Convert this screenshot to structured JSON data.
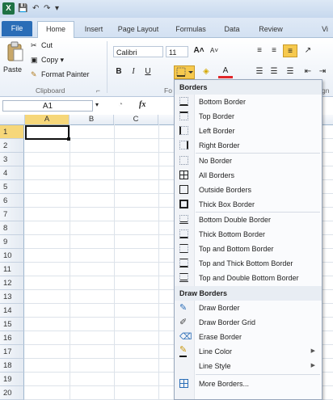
{
  "app": {
    "logo": "X"
  },
  "quick_access": {
    "save": "💾",
    "undo": "↶",
    "redo": "↷",
    "customize": "▾"
  },
  "tabs": [
    "File",
    "Home",
    "Insert",
    "Page Layout",
    "Formulas",
    "Data",
    "Review",
    "Vi"
  ],
  "clipboard": {
    "paste_label": "Paste",
    "cut_label": "Cut",
    "copy_label": "Copy ▾",
    "format_painter_label": "Format Painter",
    "group_label": "Clipboard"
  },
  "font": {
    "name": "Calibri",
    "size": "11",
    "group_label": "Fo",
    "bold": "B",
    "italic": "I",
    "underline": "U",
    "grow": "A˄",
    "shrink": "A˅",
    "font_color": "A"
  },
  "alignment_group_label": "gn",
  "formula_bar": {
    "name_box": "A1",
    "fx": "fx"
  },
  "columns": [
    "A",
    "B",
    "C"
  ],
  "rows": [
    "1",
    "2",
    "3",
    "4",
    "5",
    "6",
    "7",
    "8",
    "9",
    "10",
    "11",
    "12",
    "13",
    "14",
    "15",
    "16",
    "17",
    "18",
    "19",
    "20"
  ],
  "borders_menu": {
    "header": "Borders",
    "items": [
      "Bottom Border",
      "Top Border",
      "Left Border",
      "Right Border",
      "No Border",
      "All Borders",
      "Outside Borders",
      "Thick Box Border",
      "Bottom Double Border",
      "Thick Bottom Border",
      "Top and Bottom Border",
      "Top and Thick Bottom Border",
      "Top and Double Bottom Border"
    ],
    "draw_header": "Draw Borders",
    "draw_items": [
      "Draw Border",
      "Draw Border Grid",
      "Erase Border",
      "Line Color",
      "Line Style"
    ],
    "more": "More Borders..."
  },
  "colors": {
    "file_tab": "#2a6db7",
    "excel_green": "#1f7245",
    "selected_header": "#f6c94e"
  }
}
